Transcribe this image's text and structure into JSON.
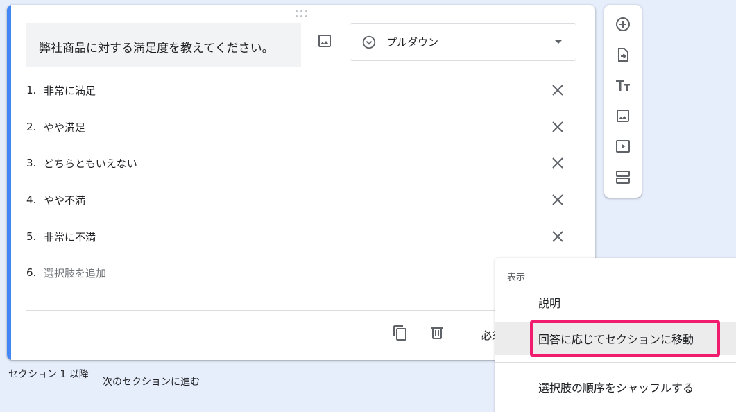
{
  "question": {
    "title": "弊社商品に対する満足度を教えてください。",
    "type_label": "プルダウン"
  },
  "options": [
    {
      "num": "1.",
      "label": "非常に満足"
    },
    {
      "num": "2.",
      "label": "やや満足"
    },
    {
      "num": "3.",
      "label": "どちらともいえない"
    },
    {
      "num": "4.",
      "label": "やや不満"
    },
    {
      "num": "5.",
      "label": "非常に不満"
    }
  ],
  "add_option": {
    "num": "6.",
    "label": "選択肢を追加"
  },
  "footer": {
    "required_label": "必須"
  },
  "section": {
    "after_label": "セクション 1 以降",
    "next_label": "次のセクションに進む"
  },
  "menu": {
    "header": "表示",
    "items": [
      {
        "label": "説明"
      },
      {
        "label": "回答に応じてセクションに移動"
      },
      {
        "label": "選択肢の順序をシャッフルする"
      }
    ]
  },
  "colors": {
    "accent": "#4285f4",
    "highlight": "#f21c6f"
  }
}
